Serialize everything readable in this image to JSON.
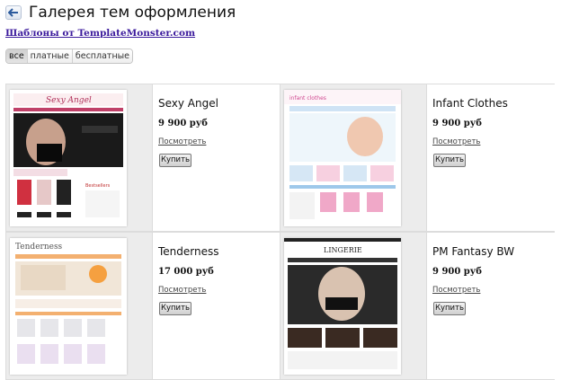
{
  "header": {
    "title": "Галерея тем оформления"
  },
  "template_monster_link": "Шаблоны от TemplateMonster.com",
  "filters": [
    {
      "label": "все",
      "active": true
    },
    {
      "label": "платные",
      "active": false
    },
    {
      "label": "бесплатные",
      "active": false
    }
  ],
  "view_label": "Посмотреть",
  "buy_label": "Купить",
  "themes": [
    {
      "name": "Sexy Angel",
      "price": "9 900 руб",
      "logo_text": "Sexy Angel"
    },
    {
      "name": "Infant Clothes",
      "price": "9 900 руб",
      "logo_text": "infant clothes"
    },
    {
      "name": "Tenderness",
      "price": "17 000 руб",
      "logo_text": "Tenderness"
    },
    {
      "name": "PM Fantasy BW",
      "price": "9 900 руб",
      "logo_text": "LINGERIE"
    }
  ],
  "colors": {
    "accent_link": "#3b1a9c",
    "cell_bg": "#ececec"
  }
}
